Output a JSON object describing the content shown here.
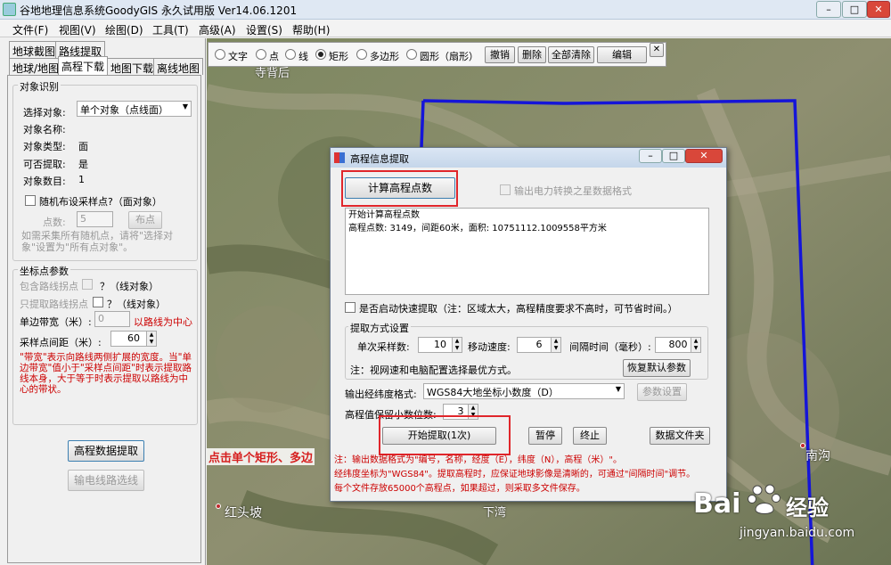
{
  "window": {
    "title": "谷地地理信息系统GoodyGIS 永久试用版 Ver14.06.1201",
    "min": "–",
    "max": "□",
    "close": "✕"
  },
  "menu": [
    "文件(F)",
    "视图(V)",
    "绘图(D)",
    "工具(T)",
    "高级(A)",
    "设置(S)",
    "帮助(H)"
  ],
  "left": {
    "tabs_row1": [
      "地球截图",
      "路线提取"
    ],
    "tabs_row2": [
      "地球/地图",
      "高程下载",
      "地图下载",
      "离线地图"
    ],
    "object_group": {
      "title": "对象识别",
      "select_label": "选择对象:",
      "select_value": "单个对象（点线面）",
      "name_label": "对象名称:",
      "name_value": "",
      "type_label": "对象类型:",
      "type_value": "面",
      "extract_label": "可否提取:",
      "extract_value": "是",
      "count_label": "对象数目:",
      "count_value": "1",
      "random_label": "随机布设采样点?（面对象）",
      "points_label": "点数:",
      "points_value": "5",
      "place_button": "布点",
      "hint": "如需采集所有随机点，请将\"选择对象\"设置为\"所有点对象\"。"
    },
    "coord_group": {
      "title": "坐标点参数",
      "include_nodes": "包含路线拐点",
      "include_nodes_q": "？（线对象）",
      "only_nodes": "只提取路线拐点",
      "only_nodes_q": "？（线对象）",
      "band_label": "单边带宽（米）:",
      "band_value": "0",
      "band_note": "以路线为中心",
      "spacing_label": "采样点间距（米）:",
      "spacing_value": "60",
      "note": "\"带宽\"表示向路线两侧扩展的宽度。当\"单边带宽\"值小于\"采样点间距\"时表示提取路线本身，大于等于时表示提取以路线为中心的带状。"
    },
    "extract_button": "高程数据提取",
    "power_button": "输电线路选线"
  },
  "drawbar": {
    "options": [
      "文字",
      "点",
      "线",
      "矩形",
      "多边形",
      "圆形（扇形）"
    ],
    "selected": "矩形",
    "undo": "撤销",
    "delete": "删除",
    "clear_all": "全部清除",
    "edit": "编辑",
    "close": "✕"
  },
  "map": {
    "labels": [
      "寺背后",
      "南沟",
      "红头坡",
      "下湾"
    ],
    "banner": "点击单个矩形、多边"
  },
  "dialog": {
    "title": "高程信息提取",
    "compute_button": "计算高程点数",
    "power_format": "输出电力转换之星数据格式",
    "log_line1": "开始计算高程点数",
    "log_line2": "高程点数: 3149，间距60米，面积: 10751112.1009558平方米",
    "fast_mode": "是否启动快速提取（注：区域太大，高程精度要求不高时，可节省时间。）",
    "method_group": "提取方式设置",
    "single_label": "单次采样数:",
    "single_value": "10",
    "speed_label": "移动速度:",
    "speed_value": "6",
    "interval_label": "间隔时间（毫秒）:",
    "interval_value": "800",
    "method_note": "注：视网速和电脑配置选择最优方式。",
    "restore_button": "恢复默认参数",
    "format_label": "输出经纬度格式:",
    "format_value": "WGS84大地坐标小数度（D）",
    "param_button": "参数设置",
    "decimals_label": "高程值保留小数位数:",
    "decimals_value": "3",
    "start_button": "开始提取(1次)",
    "pause_button": "暂停",
    "stop_button": "终止",
    "folder_button": "数据文件夹",
    "notes": [
      "注：输出数据格式为\"编号，名称，经度（E），纬度（N），高程（米）\"。",
      "经纬度坐标为\"WGS84\"。提取高程时，应保证地球影像是清晰的，可通过\"间隔时间\"调节。",
      "每个文件存放65000个高程点，如果超过，则采取多文件保存。"
    ]
  },
  "watermark": {
    "brand": "Bai",
    "brand2": "经验",
    "url": "jingyan.baidu.com"
  }
}
